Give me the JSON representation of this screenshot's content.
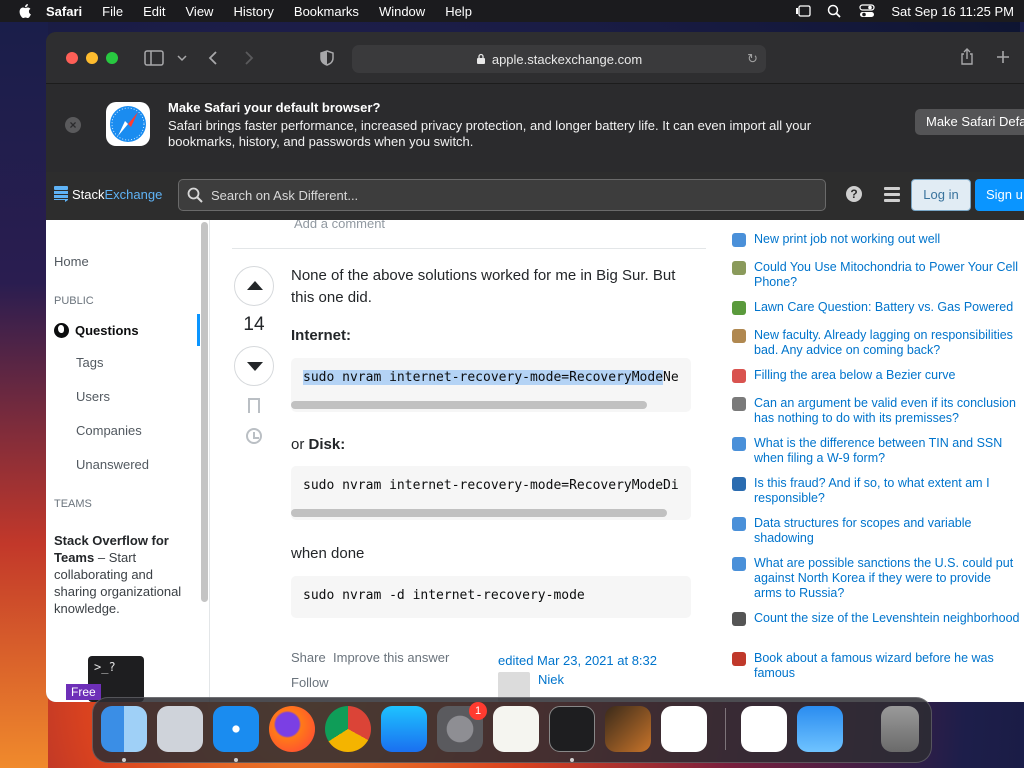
{
  "menubar": {
    "app_name": "Safari",
    "menus": [
      "File",
      "Edit",
      "View",
      "History",
      "Bookmarks",
      "Window",
      "Help"
    ],
    "datetime": "Sat Sep 16  11:25 PM"
  },
  "browser": {
    "url": "apple.stackexchange.com"
  },
  "banner": {
    "title": "Make Safari your default browser?",
    "description": "Safari brings faster performance, increased privacy protection, and longer battery life. It can even import all your bookmarks, history, and passwords when you switch.",
    "button_label": "Make Safari Defa"
  },
  "site_header": {
    "logo_stack": "Stack",
    "logo_exchange": "Exchange",
    "search_placeholder": "Search on Ask Different...",
    "help_glyph": "?",
    "login_label": "Log in",
    "signup_label": "Sign u"
  },
  "left_nav": {
    "home": "Home",
    "public_label": "PUBLIC",
    "questions": "Questions",
    "items": [
      "Tags",
      "Users",
      "Companies",
      "Unanswered"
    ],
    "teams_label": "TEAMS",
    "teams_title": "Stack Overflow for Teams",
    "teams_text": " – Start collaborating and sharing organizational knowledge.",
    "teams_image_text": ">_?",
    "free_badge": "Free"
  },
  "answer": {
    "add_comment": "Add a comment",
    "vote_count": "14",
    "intro": "None of the above solutions worked for me in Big Sur. But this one did.",
    "internet_label": "Internet:",
    "code_internet_selected": "sudo nvram internet-recovery-mode=RecoveryMode",
    "code_internet_rest": "Ne",
    "or_text": "or ",
    "disk_label": "Disk:",
    "code_disk": "sudo nvram internet-recovery-mode=RecoveryModeDi",
    "when_done": "when done",
    "code_done": "sudo nvram -d internet-recovery-mode",
    "share": "Share",
    "improve": "Improve this answer",
    "follow": "Follow",
    "edited": "edited Mar 23, 2021 at 8:32",
    "user": "Niek"
  },
  "hot_questions": [
    {
      "title": "New print job not working out well",
      "icon_color": "#4a90d9"
    },
    {
      "title": "Could You Use Mitochondria to Power Your Cell Phone?",
      "icon_color": "#8a9a5b"
    },
    {
      "title": "Lawn Care Question: Battery vs. Gas Powered",
      "icon_color": "#5a9a3c"
    },
    {
      "title": "New faculty. Already lagging on responsibilities bad. Any advice on coming back?",
      "icon_color": "#b08850"
    },
    {
      "title": "Filling the area below a Bezier curve",
      "icon_color": "#d9534f"
    },
    {
      "title": "Can an argument be valid even if its conclusion has nothing to do with its premisses?",
      "icon_color": "#7a7a7a"
    },
    {
      "title": "What is the difference between TIN and SSN when filing a W-9 form?",
      "icon_color": "#4a90d9"
    },
    {
      "title": "Is this fraud? And if so, to what extent am I responsible?",
      "icon_color": "#2b6cb0"
    },
    {
      "title": "Data structures for scopes and variable shadowing",
      "icon_color": "#4a90d9"
    },
    {
      "title": "What are possible sanctions the U.S. could put against North Korea if they were to provide arms to Russia?",
      "icon_color": "#4a90d9"
    },
    {
      "title": "Count the size of the Levenshtein neighborhood",
      "icon_color": "#555555"
    },
    {
      "title": "Book about a famous wizard before he was famous",
      "icon_color": "#c0392b"
    }
  ],
  "dock": {
    "apps": [
      "finder-icon",
      "launchpad-icon",
      "safari-icon",
      "firefox-icon",
      "chrome-icon",
      "app-store-icon",
      "system-settings-icon",
      "textedit-icon",
      "terminal-icon",
      "garageband-icon",
      "vscode-icon",
      "visual-studio-icon",
      "weather-icon",
      "trash-icon"
    ],
    "settings_badge": "1"
  }
}
